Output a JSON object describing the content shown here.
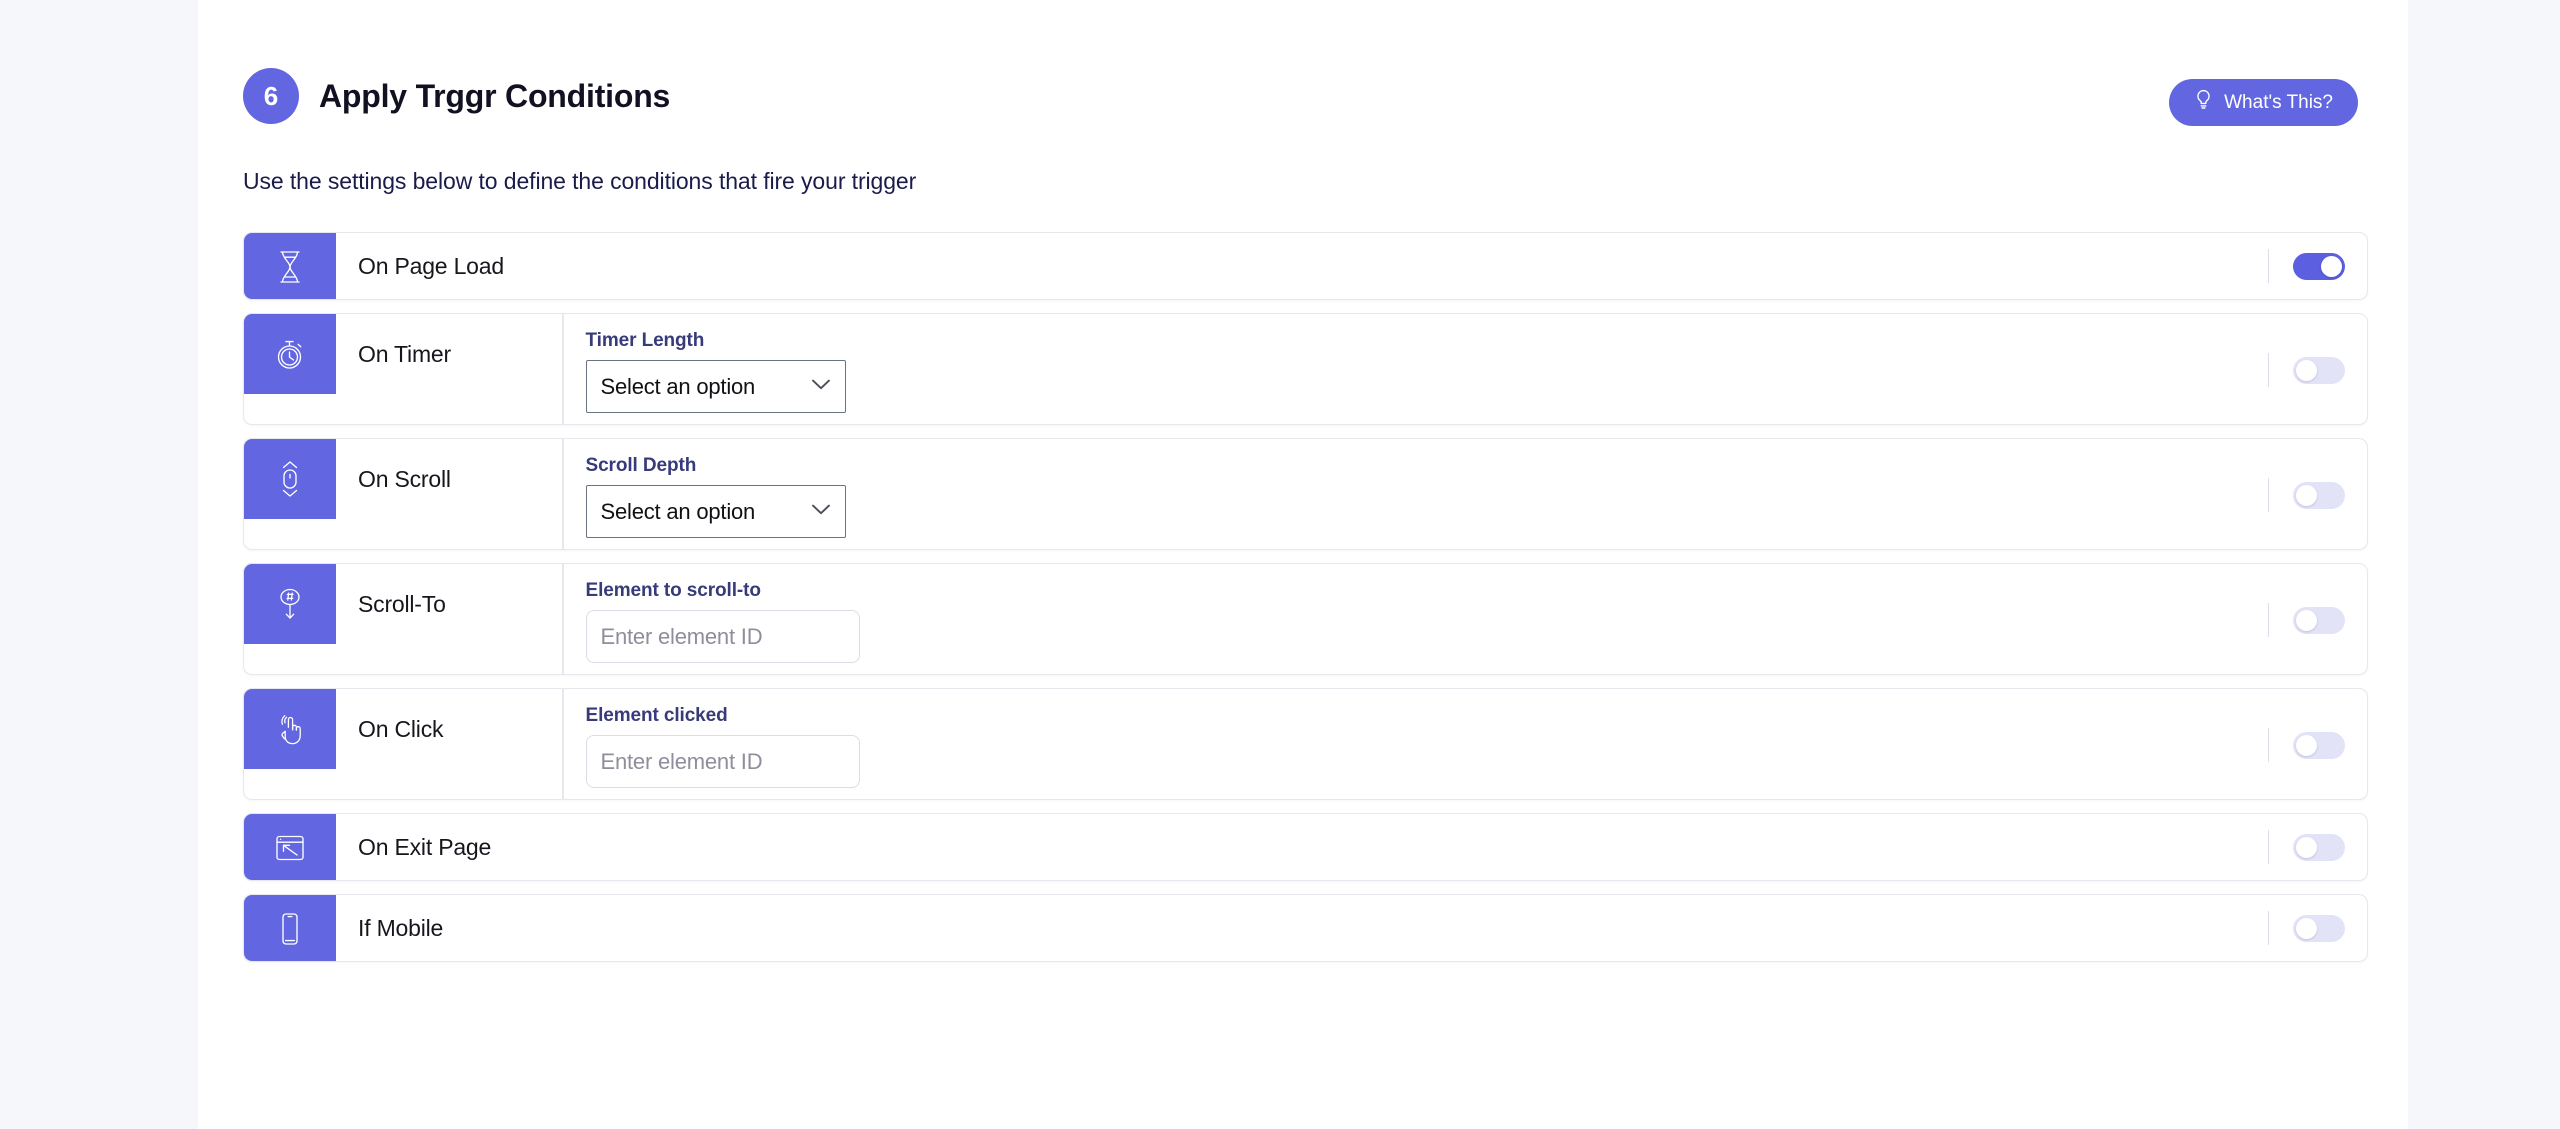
{
  "header": {
    "step_number": "6",
    "title": "Apply Trggr Conditions",
    "subtitle": "Use the settings below to define the conditions that fire your trigger",
    "help_button": {
      "label": "What's This?",
      "icon": "lightbulb-icon"
    }
  },
  "colors": {
    "accent": "#6366e1",
    "toggle_on": "#5b5fe0",
    "toggle_off": "#e3e3f8",
    "page_background": "#f6f7fa",
    "card_background": "#ffffff",
    "title_text": "#111122",
    "subtitle_text": "#1b1b4b",
    "field_label_text": "#373b7a",
    "row_border": "#e7e7ee"
  },
  "conditions": [
    {
      "id": "on-page-load",
      "label": "On Page Load",
      "icon": "hourglass-icon",
      "field": null,
      "toggle": {
        "state": "on",
        "label": "On Page Load toggle"
      }
    },
    {
      "id": "on-timer",
      "label": "On Timer",
      "icon": "stopwatch-icon",
      "field": {
        "type": "select",
        "label": "Timer Length",
        "value": "Select an option",
        "chevron": "chevron-down-icon"
      },
      "toggle": {
        "state": "off",
        "label": "On Timer toggle"
      }
    },
    {
      "id": "on-scroll",
      "label": "On Scroll",
      "icon": "mouse-scroll-icon",
      "field": {
        "type": "select",
        "label": "Scroll Depth",
        "value": "Select an option",
        "chevron": "chevron-down-icon"
      },
      "toggle": {
        "state": "off",
        "label": "On Scroll toggle"
      }
    },
    {
      "id": "scroll-to",
      "label": "Scroll-To",
      "icon": "anchor-down-arrow-icon",
      "field": {
        "type": "text",
        "label": "Element to scroll-to",
        "value": "",
        "placeholder": "Enter element ID"
      },
      "toggle": {
        "state": "off",
        "label": "Scroll-To toggle"
      }
    },
    {
      "id": "on-click",
      "label": "On Click",
      "icon": "pointing-hand-icon",
      "field": {
        "type": "text",
        "label": "Element clicked",
        "value": "",
        "placeholder": "Enter element ID"
      },
      "toggle": {
        "state": "off",
        "label": "On Click toggle"
      }
    },
    {
      "id": "on-exit-page",
      "label": "On Exit Page",
      "icon": "exit-window-icon",
      "field": null,
      "toggle": {
        "state": "off",
        "label": "On Exit Page toggle"
      }
    },
    {
      "id": "if-mobile",
      "label": "If Mobile",
      "icon": "mobile-phone-icon",
      "field": null,
      "toggle": {
        "state": "off",
        "label": "If Mobile toggle"
      }
    }
  ]
}
